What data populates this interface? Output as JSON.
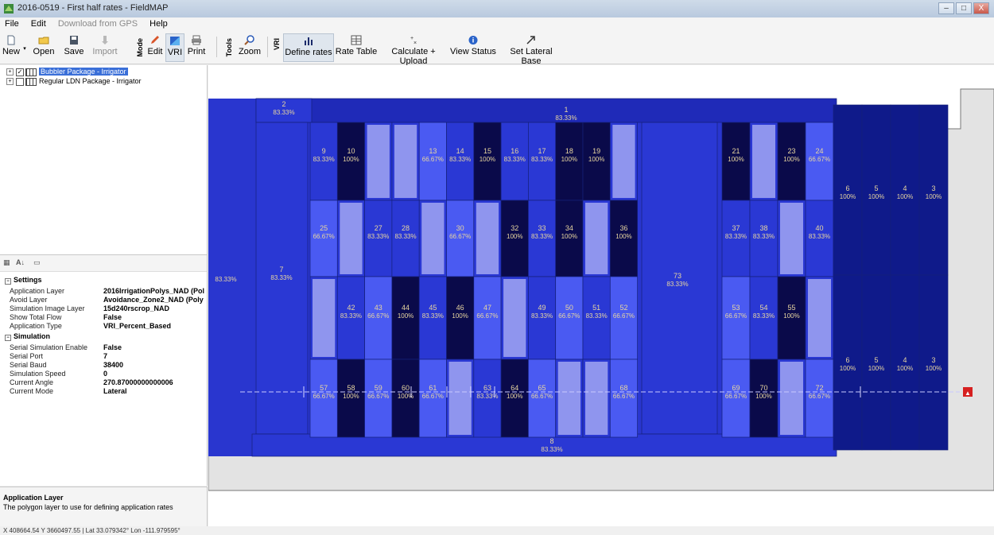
{
  "window": {
    "title": "2016-0519 - First half rates - FieldMAP",
    "min": "–",
    "max": "□",
    "close": "X"
  },
  "menu": [
    {
      "label": "File",
      "enabled": true
    },
    {
      "label": "Edit",
      "enabled": true
    },
    {
      "label": "Download from GPS",
      "enabled": false
    },
    {
      "label": "Help",
      "enabled": true
    }
  ],
  "toolbar": {
    "new": "New",
    "open": "Open",
    "save": "Save",
    "import": "Import",
    "mode": "Mode",
    "edit": "Edit",
    "vri": "VRI",
    "print": "Print",
    "tools": "Tools",
    "zoom": "Zoom",
    "vri2": "VRI",
    "define_rates": "Define rates",
    "rate_table": "Rate Table",
    "calculate_upload": "Calculate + Upload",
    "view_status": "View Status",
    "set_lateral_base": "Set Lateral Base"
  },
  "layers": [
    {
      "name": "Bubbler Package - Irrigator",
      "checked": true,
      "selected": true
    },
    {
      "name": "Regular LDN Package - Irrigator",
      "checked": false,
      "selected": false
    }
  ],
  "properties": {
    "settings_label": "Settings",
    "settings": [
      {
        "k": "Application Layer",
        "v": "2016IrrigationPolys_NAD (Pol"
      },
      {
        "k": "Avoid Layer",
        "v": "Avoidance_Zone2_NAD (Poly"
      },
      {
        "k": "Simulation Image Layer",
        "v": "15d240rscrop_NAD"
      },
      {
        "k": "Show Total Flow",
        "v": "False"
      },
      {
        "k": "Application Type",
        "v": "VRI_Percent_Based"
      }
    ],
    "simulation_label": "Simulation",
    "simulation": [
      {
        "k": "Serial Simulation Enable",
        "v": "False"
      },
      {
        "k": "Serial Port",
        "v": "7"
      },
      {
        "k": "Serial Baud",
        "v": "38400"
      },
      {
        "k": "Simulation Speed",
        "v": "0"
      },
      {
        "k": "Current Angle",
        "v": "270.87000000000006"
      },
      {
        "k": "Current Mode",
        "v": "Lateral"
      }
    ],
    "desc_title": "Application Layer",
    "desc_text": "The polygon layer to use for defining application rates"
  },
  "status": "X 408664.54 Y 3660497.55 | Lat 33.079342° Lon -111.979595°",
  "colors": {
    "r100": "#0a0a4a",
    "r83": "#2a38d4",
    "r67": "#4a5af2",
    "light": "#8f95ee",
    "base": "#2936cf",
    "strip": "#1f2ab8",
    "dark_outer": "#0f1a8a",
    "label": "#e8d6a0"
  },
  "map": {
    "lateral_marker": "▲",
    "zones": [
      {
        "id": "2",
        "rate": "83.33%"
      },
      {
        "id": "1",
        "rate": "83.33%"
      },
      {
        "id": "",
        "rate": "83.33%"
      },
      {
        "id": "7",
        "rate": "83.33%"
      },
      {
        "id": "73",
        "rate": "83.33%"
      },
      {
        "id": "8",
        "rate": "83.33%"
      },
      {
        "id": "9",
        "rate": "83.33%"
      },
      {
        "id": "10",
        "rate": "100%"
      },
      {
        "id": "",
        "rate": ""
      },
      {
        "id": "",
        "rate": ""
      },
      {
        "id": "13",
        "rate": "66.67%"
      },
      {
        "id": "14",
        "rate": "83.33%"
      },
      {
        "id": "15",
        "rate": "100%"
      },
      {
        "id": "16",
        "rate": "83.33%"
      },
      {
        "id": "17",
        "rate": "83.33%"
      },
      {
        "id": "18",
        "rate": "100%"
      },
      {
        "id": "19",
        "rate": "100%"
      },
      {
        "id": "",
        "rate": ""
      },
      {
        "id": "25",
        "rate": "66.67%"
      },
      {
        "id": "",
        "rate": ""
      },
      {
        "id": "27",
        "rate": "83.33%"
      },
      {
        "id": "28",
        "rate": "83.33%"
      },
      {
        "id": "",
        "rate": ""
      },
      {
        "id": "30",
        "rate": "66.67%"
      },
      {
        "id": "",
        "rate": ""
      },
      {
        "id": "32",
        "rate": "100%"
      },
      {
        "id": "33",
        "rate": "83.33%"
      },
      {
        "id": "34",
        "rate": "100%"
      },
      {
        "id": "",
        "rate": ""
      },
      {
        "id": "36",
        "rate": "100%"
      },
      {
        "id": "",
        "rate": ""
      },
      {
        "id": "42",
        "rate": "83.33%"
      },
      {
        "id": "43",
        "rate": "66.67%"
      },
      {
        "id": "44",
        "rate": "100%"
      },
      {
        "id": "45",
        "rate": "83.33%"
      },
      {
        "id": "46",
        "rate": "100%"
      },
      {
        "id": "47",
        "rate": "66.67%"
      },
      {
        "id": "",
        "rate": ""
      },
      {
        "id": "49",
        "rate": "83.33%"
      },
      {
        "id": "50",
        "rate": "66.67%"
      },
      {
        "id": "51",
        "rate": "83.33%"
      },
      {
        "id": "52",
        "rate": "66.67%"
      },
      {
        "id": "57",
        "rate": "66.67%"
      },
      {
        "id": "58",
        "rate": "100%"
      },
      {
        "id": "59",
        "rate": "66.67%"
      },
      {
        "id": "60",
        "rate": "100%"
      },
      {
        "id": "61",
        "rate": "66.67%"
      },
      {
        "id": "",
        "rate": ""
      },
      {
        "id": "63",
        "rate": "83.33%"
      },
      {
        "id": "64",
        "rate": "100%"
      },
      {
        "id": "65",
        "rate": "66.67%"
      },
      {
        "id": "",
        "rate": ""
      },
      {
        "id": "",
        "rate": ""
      },
      {
        "id": "68",
        "rate": "66.67%"
      },
      {
        "id": "21",
        "rate": "100%"
      },
      {
        "id": "",
        "rate": ""
      },
      {
        "id": "23",
        "rate": "100%"
      },
      {
        "id": "24",
        "rate": "66.67%"
      },
      {
        "id": "37",
        "rate": "83.33%"
      },
      {
        "id": "38",
        "rate": "83.33%"
      },
      {
        "id": "",
        "rate": ""
      },
      {
        "id": "40",
        "rate": "83.33%"
      },
      {
        "id": "53",
        "rate": "66.67%"
      },
      {
        "id": "54",
        "rate": "83.33%"
      },
      {
        "id": "55",
        "rate": "100%"
      },
      {
        "id": "",
        "rate": ""
      },
      {
        "id": "69",
        "rate": "66.67%"
      },
      {
        "id": "70",
        "rate": "100%"
      },
      {
        "id": "",
        "rate": ""
      },
      {
        "id": "72",
        "rate": "66.67%"
      },
      {
        "id": "6",
        "rate": "100%"
      },
      {
        "id": "5",
        "rate": "100%"
      },
      {
        "id": "4",
        "rate": "100%"
      },
      {
        "id": "3",
        "rate": "100%"
      },
      {
        "id": "6",
        "rate": "100%"
      },
      {
        "id": "5",
        "rate": "100%"
      },
      {
        "id": "4",
        "rate": "100%"
      },
      {
        "id": "3",
        "rate": "100%"
      }
    ]
  }
}
